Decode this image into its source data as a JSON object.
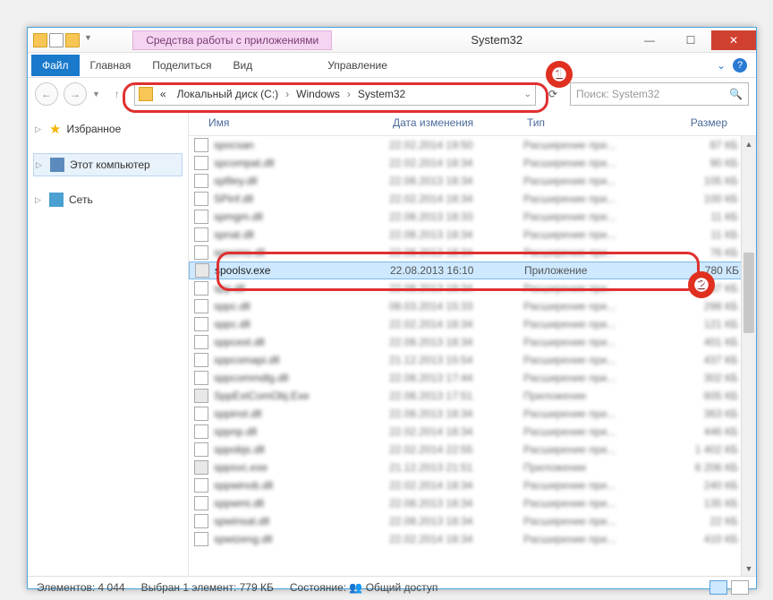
{
  "window": {
    "title": "System32"
  },
  "ribbon": {
    "context_tab": "Средства работы с приложениями"
  },
  "tabs": {
    "file": "Файл",
    "home": "Главная",
    "share": "Поделиться",
    "view": "Вид",
    "manage": "Управление"
  },
  "address": {
    "sep_pre": "«",
    "crumb1": "Локальный диск (C:)",
    "crumb2": "Windows",
    "crumb3": "System32",
    "sep": "›"
  },
  "search": {
    "placeholder": "Поиск: System32"
  },
  "sidebar": {
    "fav": "Избранное",
    "pc": "Этот компьютер",
    "net": "Сеть"
  },
  "columns": {
    "name": "Имя",
    "date": "Дата изменения",
    "type": "Тип",
    "size": "Размер"
  },
  "files": [
    {
      "name": "spocsan",
      "date": "22.02.2014 19:50",
      "type": "Расширение при...",
      "size": "87 КБ",
      "blur": true
    },
    {
      "name": "spcompat.dll",
      "date": "22.02.2014 18:34",
      "type": "Расширение при...",
      "size": "90 КБ",
      "blur": true
    },
    {
      "name": "spfiley.dll",
      "date": "22.08.2013 18:34",
      "type": "Расширение при...",
      "size": "105 КБ",
      "blur": true
    },
    {
      "name": "SPinf.dll",
      "date": "22.02.2014 18:34",
      "type": "Расширение при...",
      "size": "100 КБ",
      "blur": true
    },
    {
      "name": "spmgm.dll",
      "date": "22.08.2013 18:33",
      "type": "Расширение при...",
      "size": "11 КБ",
      "blur": true
    },
    {
      "name": "spnat.dll",
      "date": "22.08.2013 18:34",
      "type": "Расширение при...",
      "size": "11 КБ",
      "blur": true
    },
    {
      "name": "spooms.dll",
      "date": "22.08.2013 18:34",
      "type": "Расширение при...",
      "size": "76 КБ",
      "blur": true
    },
    {
      "name": "spoolsv.exe",
      "date": "22.08.2013 16:10",
      "type": "Приложение",
      "size": "780 КБ",
      "blur": false,
      "sel": true,
      "exe": true
    },
    {
      "name": "spp.dll",
      "date": "22.08.2013 18:34",
      "type": "Расширение при...",
      "size": "87 КБ",
      "blur": true
    },
    {
      "name": "sppc.dll",
      "date": "08.03.2014 15:33",
      "type": "Расширение при...",
      "size": "298 КБ",
      "blur": true
    },
    {
      "name": "sppc.dll",
      "date": "22.02.2014 18:34",
      "type": "Расширение при...",
      "size": "121 КБ",
      "blur": true
    },
    {
      "name": "sppcext.dll",
      "date": "22.08.2013 18:34",
      "type": "Расширение при...",
      "size": "401 КБ",
      "blur": true
    },
    {
      "name": "sppcomapi.dll",
      "date": "21.12.2013 15:54",
      "type": "Расширение при...",
      "size": "437 КБ",
      "blur": true
    },
    {
      "name": "sppcommdlg.dll",
      "date": "22.08.2013 17:44",
      "type": "Расширение при...",
      "size": "302 КБ",
      "blur": true
    },
    {
      "name": "SppExtComObj.Exe",
      "date": "22.08.2013 17:51",
      "type": "Приложение",
      "size": "605 КБ",
      "blur": true,
      "exe": true
    },
    {
      "name": "sppinst.dll",
      "date": "22.08.2013 18:34",
      "type": "Расширение при...",
      "size": "363 КБ",
      "blur": true
    },
    {
      "name": "sppnp.dll",
      "date": "22.02.2014 18:34",
      "type": "Расширение при...",
      "size": "446 КБ",
      "blur": true
    },
    {
      "name": "sppobjs.dll",
      "date": "22.02.2014 22:55",
      "type": "Расширение при...",
      "size": "1 402 КБ",
      "blur": true
    },
    {
      "name": "sppsvc.exe",
      "date": "21.12.2013 21:51",
      "type": "Приложение",
      "size": "6 206 КБ",
      "blur": true,
      "exe": true
    },
    {
      "name": "sppwinob.dll",
      "date": "22.02.2014 18:34",
      "type": "Расширение при...",
      "size": "240 КБ",
      "blur": true
    },
    {
      "name": "sppwmi.dll",
      "date": "22.08.2013 18:34",
      "type": "Расширение при...",
      "size": "135 КБ",
      "blur": true
    },
    {
      "name": "spwinsat.dll",
      "date": "22.08.2013 18:34",
      "type": "Расширение при...",
      "size": "22 КБ",
      "blur": true
    },
    {
      "name": "spwizeng.dll",
      "date": "22.02.2014 18:34",
      "type": "Расширение при...",
      "size": "410 КБ",
      "blur": true
    }
  ],
  "status": {
    "count": "Элементов: 4 044",
    "selected": "Выбран 1 элемент: 779 КБ",
    "state_label": "Состояние:",
    "state_value": "Общий доступ"
  },
  "callouts": {
    "one": "1",
    "two": "2"
  }
}
